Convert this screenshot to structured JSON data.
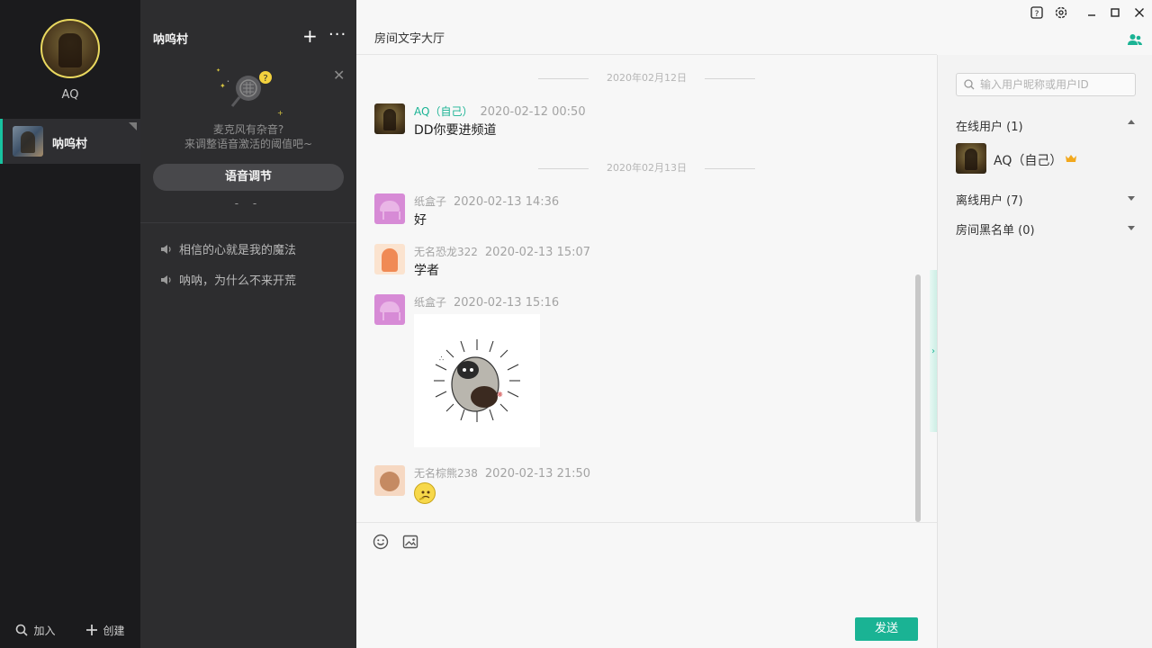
{
  "user": {
    "name": "AQ"
  },
  "rooms": [
    {
      "name": "呐呜村"
    }
  ],
  "left_bottom": {
    "join_label": "加入",
    "create_label": "创建"
  },
  "room_panel": {
    "title": "呐呜村",
    "mic_tip_line1": "麦克风有杂音?",
    "mic_tip_line2": "来调整语音激活的阈值吧~",
    "voice_button": "语音调节",
    "voice_level": "- -",
    "channels": [
      {
        "name": "相信的心就是我的魔法"
      },
      {
        "name": "呐呐，为什么不来开荒"
      }
    ]
  },
  "chat": {
    "title": "房间文字大厅",
    "dates": [
      "2020年02月12日",
      "2020年02月13日"
    ],
    "messages": [
      {
        "user": "AQ（自己）",
        "time": "2020-02-12 00:50",
        "text": "DD你要进频道"
      },
      {
        "user": "纸盒子",
        "time": "2020-02-13 14:36",
        "text": "好"
      },
      {
        "user": "无名恐龙322",
        "time": "2020-02-13 15:07",
        "text": "学者"
      },
      {
        "user": "纸盒子",
        "time": "2020-02-13 15:16",
        "text": ""
      },
      {
        "user": "无名棕熊238",
        "time": "2020-02-13 21:50",
        "text": ""
      }
    ],
    "send_label": "发送"
  },
  "members": {
    "search_placeholder": "输入用户昵称或用户ID",
    "online_title": "在线用户 (1)",
    "online_users": [
      {
        "name": "AQ（自己）"
      }
    ],
    "offline_title": "离线用户 (7)",
    "blacklist_title": "房间黑名单 (0)"
  },
  "colors": {
    "accent": "#1ab394",
    "self_name": "#1ab394"
  }
}
